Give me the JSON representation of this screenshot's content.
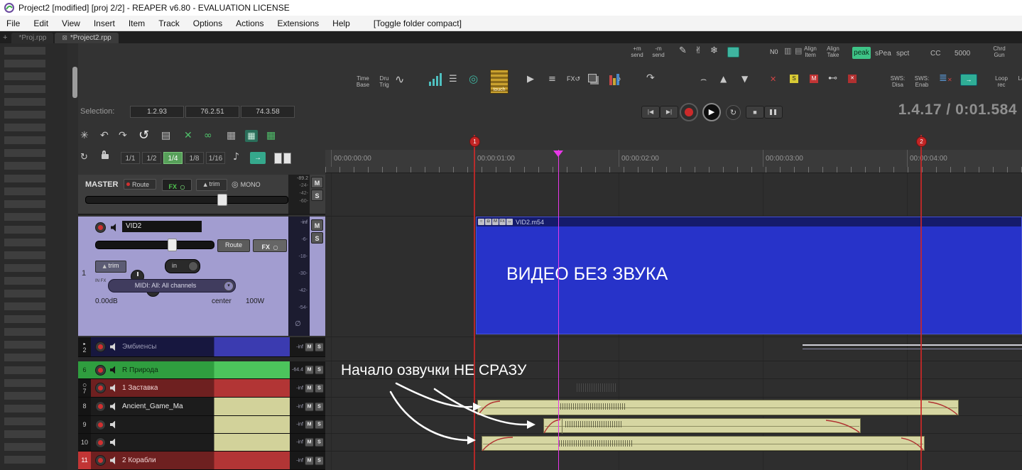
{
  "window": {
    "title": "Project2 [modified] [proj 2/2] - REAPER v6.80 - EVALUATION LICENSE"
  },
  "menu": {
    "items": [
      "File",
      "Edit",
      "View",
      "Insert",
      "Item",
      "Track",
      "Options",
      "Actions",
      "Extensions",
      "Help"
    ],
    "toggle": "[Toggle folder compact]"
  },
  "tabs": {
    "add": "+",
    "inactive": "*Proj.rpp",
    "active": "*Project2.rpp"
  },
  "toolbar1": {
    "m_send_add": "+m send",
    "m_send_remove": "-m send",
    "n0": "N0",
    "align_item": "Align Item",
    "align_take": "Align Take",
    "peak": "peak",
    "spea": "sPea",
    "spct": "spct",
    "cc": "CC",
    "num5000": "5000",
    "chrd_gun": "Chrd Gun"
  },
  "toolbar2": {
    "time_base": "Time Base",
    "dru_trig": "Dru Trig",
    "touch": "touch",
    "fx": "FX",
    "s_badge": "S",
    "m_badge": "M",
    "sws_disa": "SWS: Disa",
    "sws_enab": "SWS: Enab",
    "loop_rec": "Loop rec",
    "la": "La"
  },
  "selection": {
    "label": "Selection:",
    "values": [
      "1.2.93",
      "76.2.51",
      "74.3.58"
    ]
  },
  "transport": {
    "time": "1.4.17 / 0:01.584"
  },
  "grid_divisions": {
    "items": [
      "1/1",
      "1/2",
      "1/4",
      "1/8",
      "1/16"
    ],
    "selected": "1/4"
  },
  "labels": {
    "mute": "M",
    "solo": "S"
  },
  "master": {
    "name": "MASTER",
    "route": "Route",
    "fx": "FX",
    "trim": "trim",
    "mono": "MONO",
    "peak_readout": "-89.2",
    "scale": [
      "-24-",
      "-42-",
      "-60-"
    ]
  },
  "vid2": {
    "number": "1",
    "name": "VID2",
    "route": "Route",
    "fx": "FX",
    "trim": "trim",
    "input": "in",
    "infx": "IN FX",
    "midi": "MIDI: All: All channels",
    "volume": "0.00dB",
    "pan": "center",
    "width": "100W",
    "scale": [
      "-inf",
      "-6-",
      "-18-",
      "-30-",
      "-42-",
      "-54-"
    ]
  },
  "tracks": [
    {
      "number": "2",
      "name": "Эмбиенсы",
      "level": "-inf"
    },
    {
      "number": "6",
      "name": "R Природа",
      "level": "-64.4"
    },
    {
      "number": "7",
      "name": "1 Заставка",
      "level": "-inf"
    },
    {
      "number": "8",
      "name": "Ancient_Game_Ma",
      "level": "-inf"
    },
    {
      "number": "9",
      "name": "",
      "level": "-inf"
    },
    {
      "number": "10",
      "name": "",
      "level": "-inf"
    },
    {
      "number": "11",
      "name": "2 Корабли",
      "level": "-inf"
    }
  ],
  "ruler": {
    "times": [
      "00:00:00:00",
      "00:00:01:00",
      "00:00:02:00",
      "00:00:03:00",
      "00:00:04:00"
    ],
    "marker1": "1",
    "marker2": "2"
  },
  "arrange": {
    "video_item": "VID2.m54",
    "video_overlay": "ВИДЕО БЕЗ ЗВУКА",
    "annotation": "Начало озвучки НЕ СРАЗУ"
  },
  "icons": {
    "pencil": "✎",
    "hand": "✌",
    "snowflake": "❄",
    "grid_v": "▥",
    "grid_h": "▤",
    "burst": "✳",
    "undo": "↶",
    "redo": "↷",
    "undo_big": "↺",
    "panel": "▤",
    "cross": "✕",
    "link": "∞",
    "grid": "▦",
    "loop": "↻",
    "note": "♪",
    "arrow_right": "→",
    "wave": "∿",
    "list": "☰",
    "ring": "◎",
    "play": "▶",
    "menu": "≡",
    "fx_loop": "↺",
    "curve": "⌢",
    "envelope": "↷",
    "up": "▲",
    "down": "▼",
    "plug": "⊷",
    "doc": "≣",
    "prev": "|◀",
    "next": "▶|",
    "stop": "■",
    "power": "○",
    "lock_box": "◘",
    "pan": "↔",
    "null": "∅",
    "dropdown": "▾",
    "collapse": "▸",
    "dot": "○"
  },
  "colors": {
    "accent_green": "#3ec487",
    "record_red": "#c83232",
    "playhead": "#e838e8",
    "marker_red": "#c02a2a",
    "video_blue": "#2733c9",
    "item_khaki": "#d6d6a2"
  }
}
